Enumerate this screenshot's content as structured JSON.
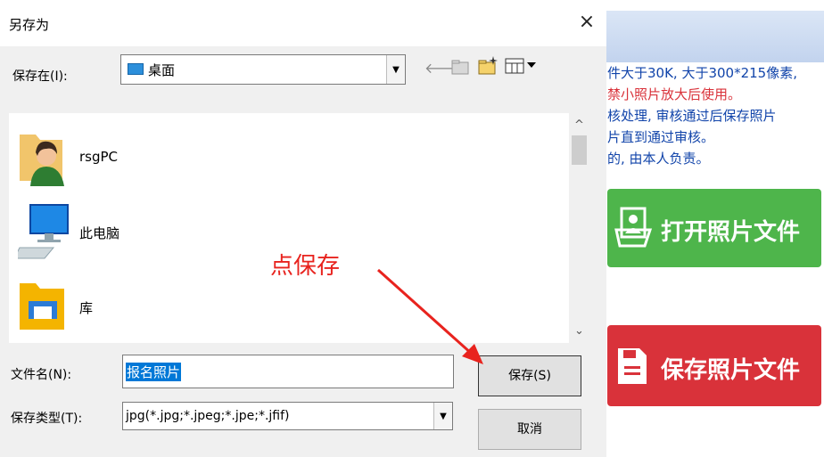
{
  "dialog": {
    "title": "另存为",
    "close_glyph": "×",
    "save_in_label": "保存在(I):",
    "location_value": "桌面",
    "toolbar_icons": [
      "back-arrow-icon",
      "up-folder-icon",
      "new-folder-icon",
      "view-menu-icon"
    ],
    "items": [
      {
        "label": "rsgPC",
        "icon": "user-folder-icon"
      },
      {
        "label": "此电脑",
        "icon": "computer-icon"
      },
      {
        "label": "库",
        "icon": "library-folder-icon"
      }
    ],
    "filename_label": "文件名(N):",
    "filename_value": "报名照片",
    "filetype_label": "保存类型(T):",
    "filetype_value": "jpg(*.jpg;*.jpeg;*.jpe;*.jfif)",
    "save_button": "保存(S)",
    "cancel_button": "取消"
  },
  "annotation": {
    "text": "点保存",
    "color": "#e8231e"
  },
  "side_panel": {
    "lines": [
      "件大于30K, 大于300*215像素,",
      "禁小照片放大后使用。",
      "核处理, 审核通过后保存照片",
      "片直到通过审核。",
      "的, 由本人负责。"
    ],
    "open_button": "打开照片文件",
    "save_button": "保存照片文件",
    "colors": {
      "green": "#4eb54b",
      "red": "#d9323a",
      "text": "#1144aa"
    }
  }
}
